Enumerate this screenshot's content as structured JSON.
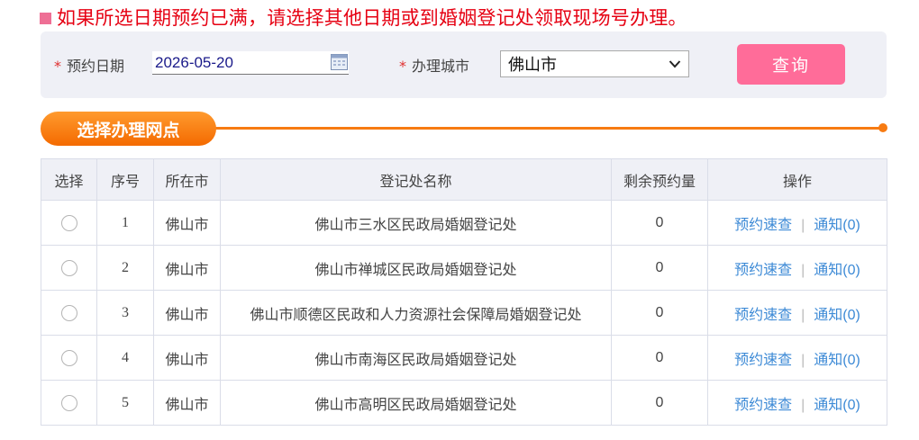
{
  "notice": {
    "text": "如果所选日期预约已满，请选择其他日期或到婚姻登记处领取现场号办理。"
  },
  "search": {
    "date_label": "预约日期",
    "date_value": "2026-05-20",
    "city_label": "办理城市",
    "city_value": "佛山市",
    "query_label": "查询",
    "required_mark": "*"
  },
  "section": {
    "title": "选择办理网点"
  },
  "table": {
    "headers": [
      "选择",
      "序号",
      "所在市",
      "登记处名称",
      "剩余预约量",
      "操作"
    ],
    "rows": [
      {
        "index": "1",
        "city": "佛山市",
        "office": "佛山市三水区民政局婚姻登记处",
        "remaining": "0",
        "link1": "预约速查",
        "link2": "通知(0)"
      },
      {
        "index": "2",
        "city": "佛山市",
        "office": "佛山市禅城区民政局婚姻登记处",
        "remaining": "0",
        "link1": "预约速查",
        "link2": "通知(0)"
      },
      {
        "index": "3",
        "city": "佛山市",
        "office": "佛山市顺德区民政和人力资源社会保障局婚姻登记处",
        "remaining": "0",
        "link1": "预约速查",
        "link2": "通知(0)"
      },
      {
        "index": "4",
        "city": "佛山市",
        "office": "佛山市南海区民政局婚姻登记处",
        "remaining": "0",
        "link1": "预约速查",
        "link2": "通知(0)"
      },
      {
        "index": "5",
        "city": "佛山市",
        "office": "佛山市高明区民政局婚姻登记处",
        "remaining": "0",
        "link1": "预约速查",
        "link2": "通知(0)"
      }
    ]
  },
  "colors": {
    "accent": "#ff6c99",
    "notice": "#e60012",
    "section": "#f77b12",
    "link": "#3d8ad6"
  },
  "icons": {
    "date_picker": "calendar-icon",
    "select": "chevron-down-icon"
  }
}
